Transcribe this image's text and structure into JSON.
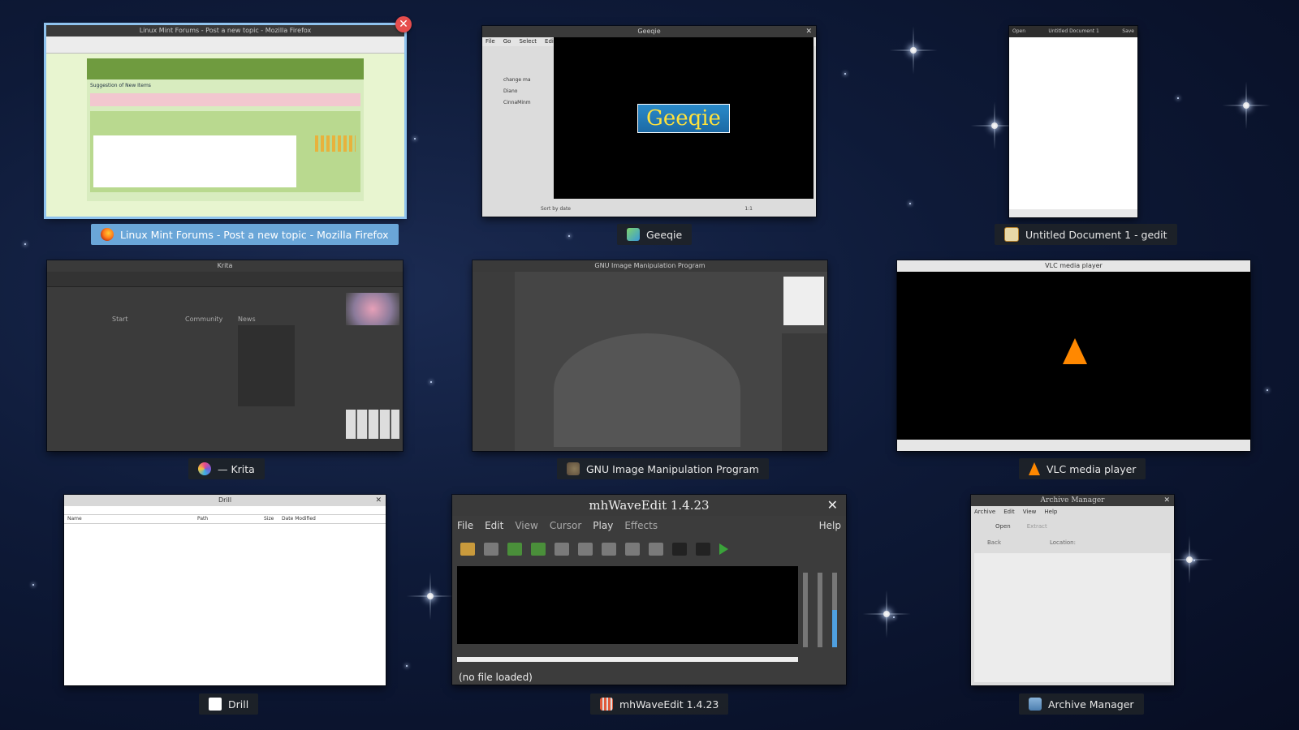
{
  "windows": [
    {
      "caption": "Linux Mint Forums - Post a new topic - Mozilla Firefox",
      "title": "Linux Mint Forums - Post a new topic - Mozilla Firefox",
      "icon": "firefox-icon",
      "selected": true,
      "content": {
        "page_heading": "Suggestion of New Items"
      }
    },
    {
      "caption": "Geeqie",
      "title": "Geeqie",
      "icon": "geeqie-icon",
      "content": {
        "menu": [
          "File",
          "Go",
          "Select",
          "Edit"
        ],
        "tree": [
          "change ma",
          "Diano",
          "CinnaMinm"
        ],
        "logo": "Geeqie",
        "status": "Sort by date",
        "zoom": "1:1"
      }
    },
    {
      "caption": "Untitled Document 1 - gedit",
      "title": "Untitled Document 1",
      "icon": "gedit-icon",
      "content": {
        "header_left": "Open",
        "header_right": "Save"
      }
    },
    {
      "caption": "— Krita",
      "title": "Krita",
      "icon": "krita-icon",
      "content": {
        "start": "Start",
        "community": "Community",
        "news": "News"
      }
    },
    {
      "caption": "GNU Image Manipulation Program",
      "title": "GNU Image Manipulation Program",
      "icon": "gimp-icon"
    },
    {
      "caption": "VLC media player",
      "title": "VLC media player",
      "icon": "vlc-icon"
    },
    {
      "caption": "Drill",
      "title": "Drill",
      "icon": "drill-icon",
      "content": {
        "columns": [
          "Name",
          "Path",
          "Size",
          "Date Modified"
        ]
      }
    },
    {
      "caption": "mhWaveEdit 1.4.23",
      "title": "mhWaveEdit 1.4.23",
      "icon": "mhwaveedit-icon",
      "content": {
        "menu": [
          "File",
          "Edit",
          "View",
          "Cursor",
          "Play",
          "Effects"
        ],
        "help": "Help",
        "status": "(no file loaded)"
      }
    },
    {
      "caption": "Archive Manager",
      "title": "Archive Manager",
      "icon": "archive-manager-icon",
      "content": {
        "menu": [
          "Archive",
          "Edit",
          "View",
          "Help"
        ],
        "open": "Open",
        "extract": "Extract",
        "back": "Back",
        "location": "Location:"
      }
    }
  ],
  "colors": {
    "selected_caption": "#6aa6d8",
    "close_badge": "#e64d4d",
    "caption_bg": "#1e2228"
  }
}
